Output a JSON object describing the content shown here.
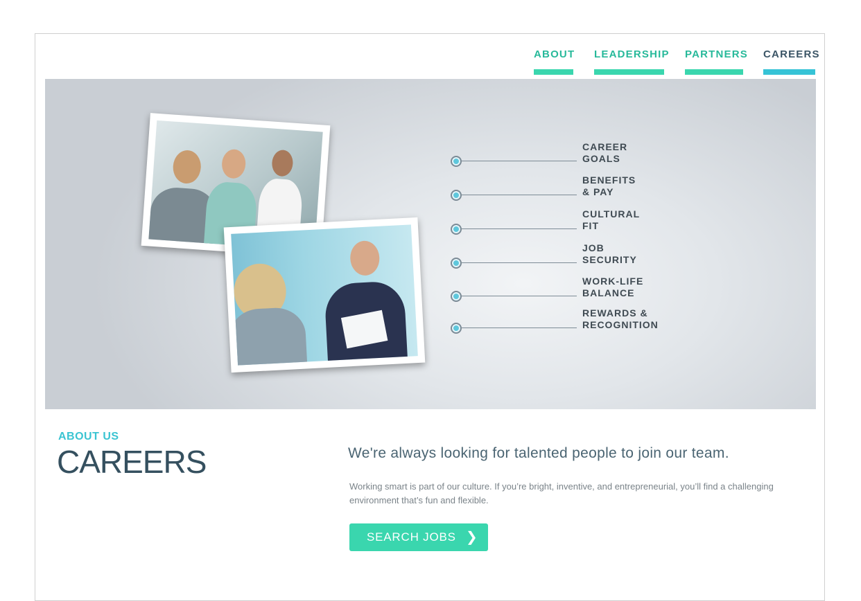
{
  "nav": {
    "items": [
      {
        "label": "ABOUT"
      },
      {
        "label": "LEADERSHIP"
      },
      {
        "label": "PARTNERS"
      },
      {
        "label": "CAREERS",
        "active": true
      }
    ]
  },
  "hero": {
    "items": [
      {
        "label": "CAREER\nGOALS"
      },
      {
        "label": "BENEFITS\n& PAY"
      },
      {
        "label": "CULTURAL\nFIT"
      },
      {
        "label": "JOB\nSECURITY"
      },
      {
        "label": "WORK-LIFE\nBALANCE"
      },
      {
        "label": "REWARDS &\nRECOGNITION"
      }
    ]
  },
  "content": {
    "eyebrow": "ABOUT US",
    "title": "CAREERS",
    "headline": "We're always looking for talented people to join our team.",
    "body": "Working smart is part of our culture. If you’re bright, inventive, and entrepreneurial, you’ll find a challenging environment that’s fun and flexible.",
    "cta_label": "SEARCH JOBS",
    "cta_icon": "chevron-right-icon"
  },
  "colors": {
    "accent_green": "#3ad6ae",
    "accent_blue": "#36c3d6",
    "title_dark": "#35505f"
  }
}
